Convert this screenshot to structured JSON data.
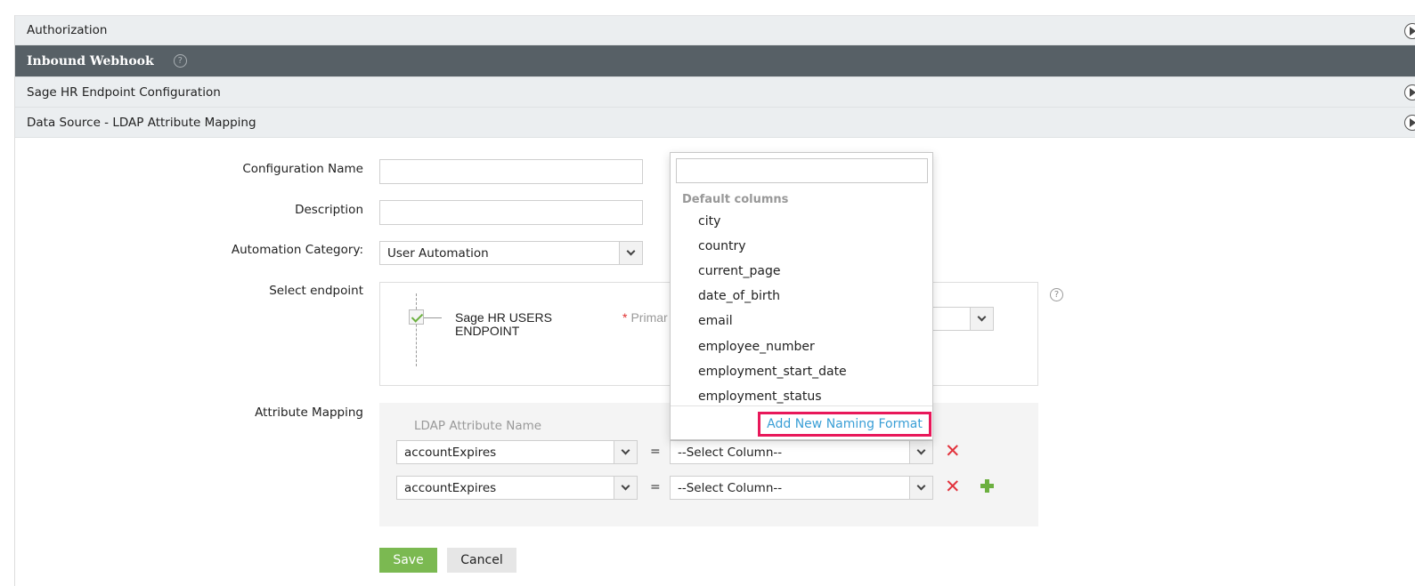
{
  "sections": [
    {
      "label": "Authorization",
      "expanded": false
    },
    {
      "label": "Inbound Webhook",
      "active": true
    },
    {
      "label": "Sage HR Endpoint Configuration",
      "expanded": false
    },
    {
      "label": "Data Source - LDAP Attribute Mapping",
      "expanded": false
    }
  ],
  "help_glyph": "?",
  "form": {
    "config_name_label": "Configuration Name",
    "config_name_value": "",
    "description_label": "Description",
    "description_value": "",
    "automation_category_label": "Automation Category:",
    "automation_category_value": "User Automation",
    "select_endpoint_label": "Select endpoint",
    "endpoint": {
      "name_line1": "Sage HR USERS",
      "name_line2": "ENDPOINT",
      "checked": true,
      "primary_required_mark": "*",
      "primary_label": "Primar"
    },
    "attribute_mapping_label": "Attribute Mapping",
    "ldap_header": "LDAP Attribute Name",
    "equals": "=",
    "mappings": [
      {
        "ldap_attribute": "accountExpires",
        "column": "--Select Column--"
      },
      {
        "ldap_attribute": "accountExpires",
        "column": "--Select Column--"
      }
    ],
    "save_label": "Save",
    "cancel_label": "Cancel"
  },
  "dropdown": {
    "search_value": "",
    "group_label": "Default columns",
    "items": [
      "city",
      "country",
      "current_page",
      "date_of_birth",
      "email",
      "employee_number",
      "employment_start_date",
      "employment_status"
    ],
    "add_label": "Add New Naming Format"
  },
  "icons": {
    "remove": "✕",
    "add": "plus-icon",
    "help": "help-icon",
    "expand": "play-circle-icon"
  },
  "colors": {
    "header_dark": "#576066",
    "save_green": "#7bb951",
    "remove_red": "#e2323c",
    "link_blue": "#3a9fd6",
    "highlight_pink": "#e8185a"
  }
}
